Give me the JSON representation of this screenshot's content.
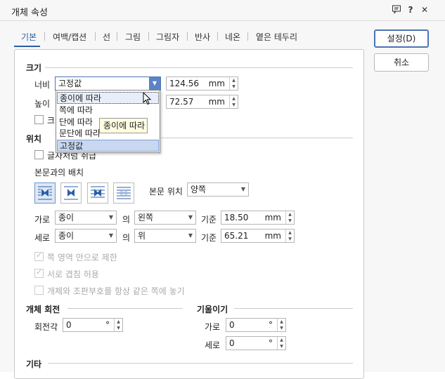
{
  "window": {
    "title": "개체 속성",
    "btn_help": "?",
    "btn_close": "✕"
  },
  "tabs": [
    "기본",
    "여백/캡션",
    "선",
    "그림",
    "그림자",
    "반사",
    "네온",
    "옅은 테두리"
  ],
  "actions": {
    "ok": "설정(D)",
    "cancel": "취소"
  },
  "size": {
    "section": "크기",
    "width_label": "너비",
    "width_mode": "고정값",
    "width_value": "124.56",
    "width_unit": "mm",
    "height_label": "높이",
    "height_value": "72.57",
    "height_unit": "mm",
    "keep_ratio_label": "크"
  },
  "dropdown": {
    "items": [
      "종이에 따라",
      "쪽에 따라",
      "단에 따라",
      "문단에 따라",
      "고정값"
    ],
    "tooltip": "종이에 따라"
  },
  "position": {
    "section": "위치",
    "treat_as_char": "글자처럼 취급",
    "wrap_label": "본문과의 배치",
    "text_pos_label": "본문 위치",
    "text_pos_value": "양쪽",
    "horiz_label": "가로",
    "horiz_ref": "종이",
    "of": "의",
    "horiz_align": "왼쪽",
    "base": "기준",
    "horiz_value": "18.50",
    "vert_label": "세로",
    "vert_ref": "종이",
    "vert_align": "위",
    "vert_value": "65.21",
    "unit": "mm",
    "limit_page": "쪽 영역 안으로 제한",
    "allow_overlap": "서로 겹침 허용",
    "same_page": "개체와 조판부호를 항상 같은 쪽에 놓기"
  },
  "rotation": {
    "section": "개체 회전",
    "angle_label": "회전각",
    "angle_value": "0",
    "deg": "°"
  },
  "skew": {
    "section": "기울이기",
    "h_label": "가로",
    "h_value": "0",
    "v_label": "세로",
    "v_value": "0"
  },
  "misc": {
    "section": "기타"
  }
}
